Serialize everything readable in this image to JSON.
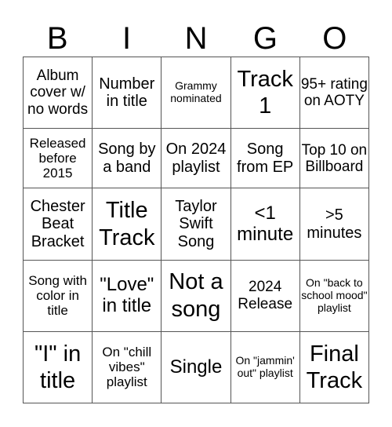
{
  "header": [
    "B",
    "I",
    "N",
    "G",
    "O"
  ],
  "rows": [
    [
      "Album cover w/ no words",
      "Number in title",
      "Grammy nominated",
      "Track 1",
      "95+ rating on AOTY"
    ],
    [
      "Released before 2015",
      "Song by a band",
      "On 2024 playlist",
      "Song from EP",
      "Top 10 on Billboard"
    ],
    [
      "Chester Beat Bracket",
      "Title Track",
      "Taylor Swift Song",
      "<1 minute",
      ">5 minutes"
    ],
    [
      "Song with color in title",
      "\"Love\" in title",
      "Not a song",
      "2024 Release",
      "On \"back to school mood\" playlist"
    ],
    [
      "\"I\" in title",
      "On \"chill vibes\" playlist",
      "Single",
      "On \"jammin' out\" playlist",
      "Final Track"
    ]
  ]
}
